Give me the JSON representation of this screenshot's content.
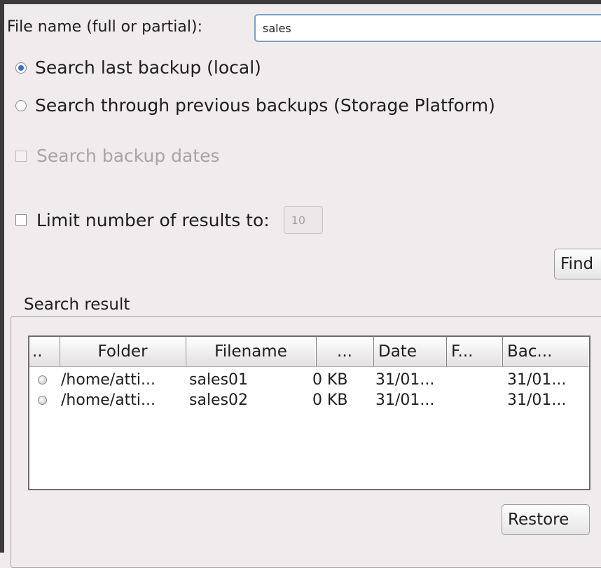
{
  "form": {
    "filename_label": "File name (full or partial):",
    "filename_value": "sales",
    "radio_last_backup": "Search last backup (local)",
    "radio_previous": "Search through previous backups (Storage Platform)",
    "check_dates": "Search backup dates",
    "check_limit": "Limit number of results to:",
    "limit_value": "10",
    "find_button": "Find"
  },
  "results": {
    "group_title": "Search result",
    "columns": [
      "..",
      "Folder",
      "Filename",
      "...",
      "Date",
      "F...",
      "Bac..."
    ],
    "rows": [
      {
        "folder": "/home/atti...",
        "filename": "sales01",
        "size": "0 KB",
        "date": "31/01...",
        "f": "",
        "backup": "31/01..."
      },
      {
        "folder": "/home/atti...",
        "filename": "sales02",
        "size": "0 KB",
        "date": "31/01...",
        "f": "",
        "backup": "31/01..."
      }
    ],
    "restore_button": "Restore"
  }
}
